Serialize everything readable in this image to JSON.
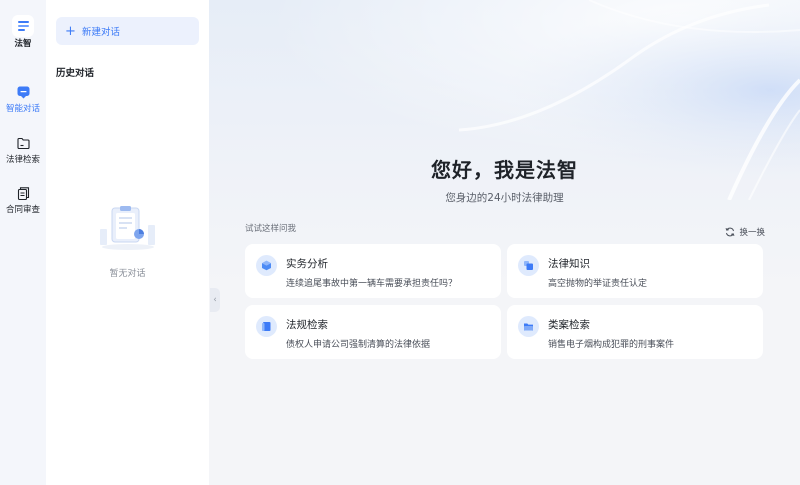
{
  "app": {
    "name": "法智"
  },
  "nav": {
    "items": [
      {
        "label": "智能对话",
        "icon": "chat-icon",
        "active": true
      },
      {
        "label": "法律检索",
        "icon": "folder-icon",
        "active": false
      },
      {
        "label": "合同审查",
        "icon": "document-icon",
        "active": false
      }
    ]
  },
  "history": {
    "new_chat_label": "新建对话",
    "title": "历史对话",
    "empty_text": "暂无对话"
  },
  "main": {
    "greeting": "您好，我是法智",
    "subtitle": "您身边的24小时法律助理",
    "try_label": "试试这样问我",
    "refresh_label": "换一换",
    "cards": [
      {
        "title": "实务分析",
        "desc": "连续追尾事故中第一辆车需要承担责任吗？",
        "icon": "cube-icon"
      },
      {
        "title": "法律知识",
        "desc": "高空抛物的举证责任认定",
        "icon": "blocks-icon"
      },
      {
        "title": "法规检索",
        "desc": "债权人申请公司强制清算的法律依据",
        "icon": "book-icon"
      },
      {
        "title": "类案检索",
        "desc": "销售电子烟构成犯罪的刑事案件",
        "icon": "folder-search-icon"
      }
    ]
  },
  "colors": {
    "accent": "#3d7bf7",
    "accent_bg": "#ecf1fd"
  }
}
